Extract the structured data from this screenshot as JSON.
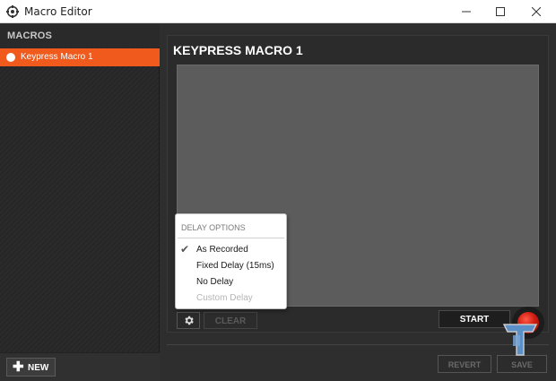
{
  "window": {
    "title": "Macro Editor"
  },
  "sidebar": {
    "title": "MACROS",
    "items": [
      {
        "label": "Keypress Macro 1",
        "selected": true
      }
    ],
    "new_label": "NEW",
    "new_icon": "plus-icon"
  },
  "editor": {
    "title": "KEYPRESS MACRO 1",
    "gear_icon": "gear-icon",
    "clear_label": "CLEAR",
    "start_label": "START",
    "revert_label": "REVERT",
    "save_label": "SAVE"
  },
  "delay_menu": {
    "header": "DELAY OPTIONS",
    "items": [
      {
        "label": "As Recorded",
        "checked": true,
        "enabled": true
      },
      {
        "label": "Fixed Delay (15ms)",
        "checked": false,
        "enabled": true
      },
      {
        "label": "No Delay",
        "checked": false,
        "enabled": true
      },
      {
        "label": "Custom Delay",
        "checked": false,
        "enabled": false
      }
    ]
  },
  "colors": {
    "accent": "#f05a1c",
    "record": "#d01c10",
    "watermark": "#5a8fc8"
  }
}
